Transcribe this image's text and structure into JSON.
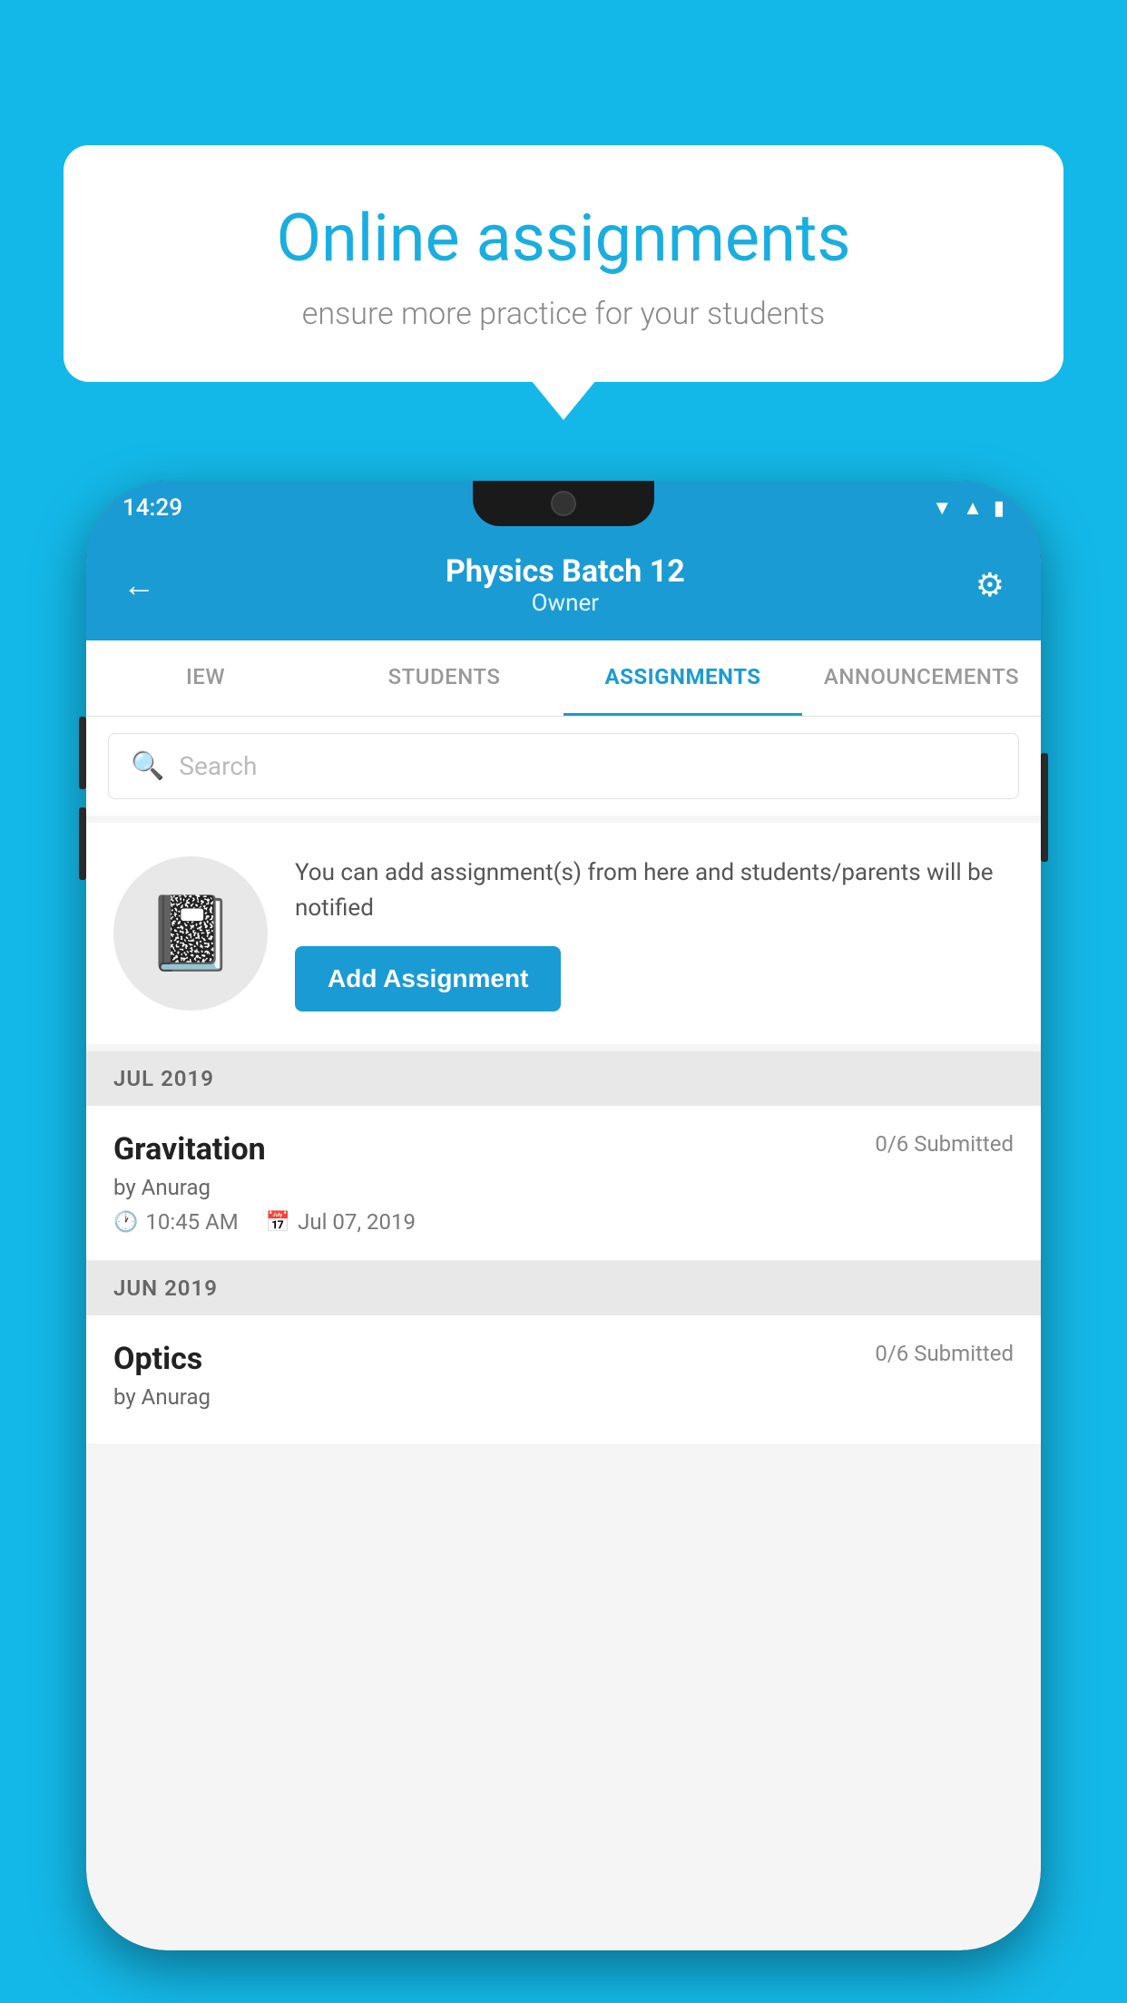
{
  "background_color": "#14B8E8",
  "speech_bubble": {
    "title": "Online assignments",
    "subtitle": "ensure more practice for your students"
  },
  "phone": {
    "status_bar": {
      "time": "14:29",
      "icons": [
        "wifi",
        "signal",
        "battery"
      ]
    },
    "header": {
      "title": "Physics Batch 12",
      "subtitle": "Owner",
      "back_label": "←",
      "settings_label": "⚙"
    },
    "tabs": [
      {
        "label": "IEW",
        "active": false
      },
      {
        "label": "STUDENTS",
        "active": false
      },
      {
        "label": "ASSIGNMENTS",
        "active": true
      },
      {
        "label": "ANNOUNCEMENTS",
        "active": false
      }
    ],
    "search": {
      "placeholder": "Search"
    },
    "promo": {
      "description": "You can add assignment(s) from here and students/parents will be notified",
      "button_label": "Add Assignment"
    },
    "sections": [
      {
        "month": "JUL 2019",
        "assignments": [
          {
            "title": "Gravitation",
            "submitted": "0/6 Submitted",
            "by": "by Anurag",
            "time": "10:45 AM",
            "date": "Jul 07, 2019"
          }
        ]
      },
      {
        "month": "JUN 2019",
        "assignments": [
          {
            "title": "Optics",
            "submitted": "0/6 Submitted",
            "by": "by Anurag",
            "time": "",
            "date": ""
          }
        ]
      }
    ]
  }
}
